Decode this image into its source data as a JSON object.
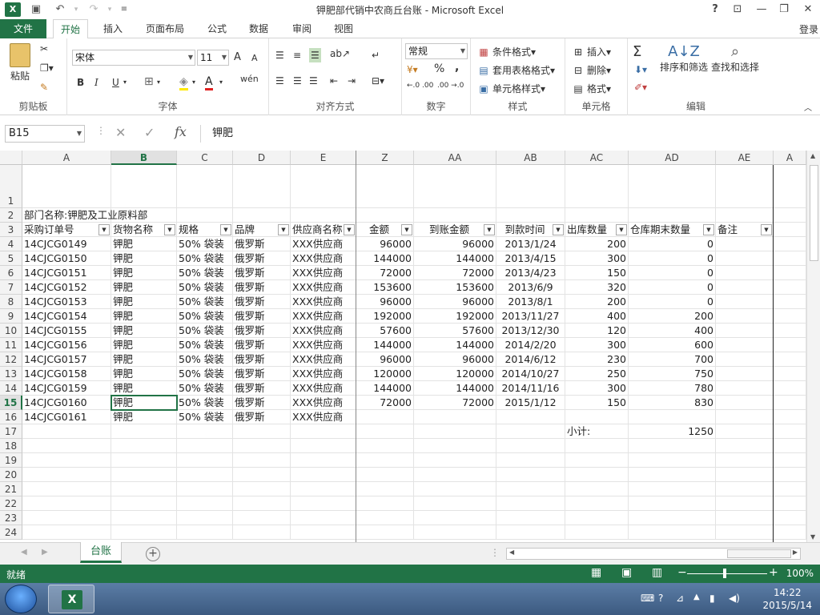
{
  "app": {
    "window_title": "钾肥部代销中农商丘台账 - Microsoft Excel",
    "login": "登录",
    "logo": "X"
  },
  "ribbon_tabs": [
    "文件",
    "开始",
    "插入",
    "页面布局",
    "公式",
    "数据",
    "审阅",
    "视图"
  ],
  "ribbon": {
    "clipboard": {
      "paste": "粘贴",
      "label": "剪贴板"
    },
    "font": {
      "name": "宋体",
      "size": "11",
      "label": "字体",
      "bold": "B",
      "italic": "I",
      "underline": "U",
      "grow": "A",
      "shrink": "A",
      "phonetic": "wén",
      "fontcolor": "A"
    },
    "align": {
      "label": "对齐方式"
    },
    "number": {
      "format": "常规",
      "percent": "%",
      "comma": ",",
      "label": "数字",
      "inc": "←.0 .00",
      "dec": ".00 →.0"
    },
    "styles": {
      "cond": "条件格式",
      "table": "套用表格格式",
      "cell": "单元格样式",
      "label": "样式"
    },
    "cells": {
      "insert": "插入",
      "delete": "删除",
      "format": "格式",
      "label": "单元格"
    },
    "edit": {
      "sort": "排序和筛选",
      "find": "查找和选择",
      "label": "编辑",
      "sum": "Σ"
    }
  },
  "formula_bar": {
    "name_box": "B15",
    "formula": "钾肥",
    "fx": "fx"
  },
  "columns": [
    {
      "id": "A",
      "label": "A"
    },
    {
      "id": "B",
      "label": "B"
    },
    {
      "id": "C",
      "label": "C"
    },
    {
      "id": "D",
      "label": "D"
    },
    {
      "id": "E",
      "label": "E"
    },
    {
      "id": "Z",
      "label": "Z"
    },
    {
      "id": "AA",
      "label": "AA"
    },
    {
      "id": "AB",
      "label": "AB"
    },
    {
      "id": "AC",
      "label": "AC"
    },
    {
      "id": "AD",
      "label": "AD"
    },
    {
      "id": "AE",
      "label": "AE"
    },
    {
      "id": "AF",
      "label": "A"
    }
  ],
  "rows": [
    "1",
    "2",
    "3",
    "4",
    "5",
    "6",
    "7",
    "8",
    "9",
    "10",
    "11",
    "12",
    "13",
    "14",
    "15",
    "16",
    "17",
    "18",
    "19",
    "20",
    "21",
    "22",
    "23",
    "24"
  ],
  "sheet": {
    "dept_label": "部门名称:钾肥及工业原料部",
    "headers": [
      "采购订单号",
      "货物名称",
      "规格",
      "品牌",
      "供应商名称",
      "金额",
      "到账金额",
      "到款时间",
      "出库数量",
      "仓库期末数量",
      "备注"
    ],
    "records": [
      [
        "14CJCG0149",
        "钾肥",
        "50% 袋装",
        "俄罗斯",
        "XXX供应商",
        "96000",
        "96000",
        "2013/1/24",
        "200",
        "0"
      ],
      [
        "14CJCG0150",
        "钾肥",
        "50% 袋装",
        "俄罗斯",
        "XXX供应商",
        "144000",
        "144000",
        "2013/4/15",
        "300",
        "0"
      ],
      [
        "14CJCG0151",
        "钾肥",
        "50% 袋装",
        "俄罗斯",
        "XXX供应商",
        "72000",
        "72000",
        "2013/4/23",
        "150",
        "0"
      ],
      [
        "14CJCG0152",
        "钾肥",
        "50% 袋装",
        "俄罗斯",
        "XXX供应商",
        "153600",
        "153600",
        "2013/6/9",
        "320",
        "0"
      ],
      [
        "14CJCG0153",
        "钾肥",
        "50% 袋装",
        "俄罗斯",
        "XXX供应商",
        "96000",
        "96000",
        "2013/8/1",
        "200",
        "0"
      ],
      [
        "14CJCG0154",
        "钾肥",
        "50% 袋装",
        "俄罗斯",
        "XXX供应商",
        "192000",
        "192000",
        "2013/11/27",
        "400",
        "200"
      ],
      [
        "14CJCG0155",
        "钾肥",
        "50% 袋装",
        "俄罗斯",
        "XXX供应商",
        "57600",
        "57600",
        "2013/12/30",
        "120",
        "400"
      ],
      [
        "14CJCG0156",
        "钾肥",
        "50% 袋装",
        "俄罗斯",
        "XXX供应商",
        "144000",
        "144000",
        "2014/2/20",
        "300",
        "600"
      ],
      [
        "14CJCG0157",
        "钾肥",
        "50% 袋装",
        "俄罗斯",
        "XXX供应商",
        "96000",
        "96000",
        "2014/6/12",
        "230",
        "700"
      ],
      [
        "14CJCG0158",
        "钾肥",
        "50% 袋装",
        "俄罗斯",
        "XXX供应商",
        "120000",
        "120000",
        "2014/10/27",
        "250",
        "750"
      ],
      [
        "14CJCG0159",
        "钾肥",
        "50% 袋装",
        "俄罗斯",
        "XXX供应商",
        "144000",
        "144000",
        "2014/11/16",
        "300",
        "780"
      ],
      [
        "14CJCG0160",
        "钾肥",
        "50% 袋装",
        "俄罗斯",
        "XXX供应商",
        "72000",
        "72000",
        "2015/1/12",
        "150",
        "830"
      ],
      [
        "14CJCG0161",
        "钾肥",
        "50% 袋装",
        "俄罗斯",
        "XXX供应商",
        "",
        "",
        "",
        "",
        ""
      ]
    ],
    "subtotal_label": "小计:",
    "subtotal_value": "1250"
  },
  "sheet_tabs": [
    "台账"
  ],
  "status": {
    "ready": "就绪",
    "zoom": "100%"
  },
  "taskbar": {
    "time": "14:22",
    "date": "2015/5/14",
    "xl": "X"
  }
}
